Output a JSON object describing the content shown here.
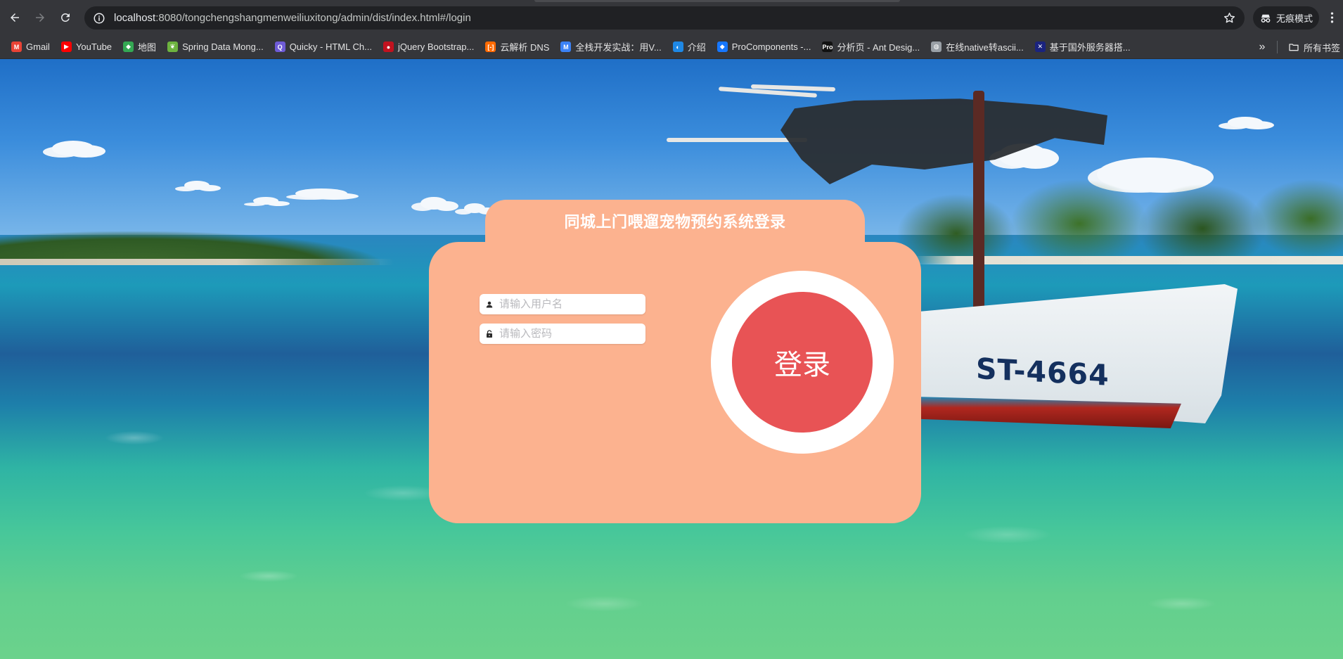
{
  "browser": {
    "url_host": "localhost",
    "url_path": ":8080/tongchengshangmenweiliuxitong/admin/dist/index.html#/login",
    "incognito_label": "无痕模式",
    "bookmarks": [
      {
        "label": "Gmail",
        "icon": "gmail-icon",
        "color": "#ea4335",
        "glyph": "M"
      },
      {
        "label": "YouTube",
        "icon": "youtube-icon",
        "color": "#ff0000",
        "glyph": "▶"
      },
      {
        "label": "地图",
        "icon": "maps-icon",
        "color": "#34a853",
        "glyph": "◆"
      },
      {
        "label": "Spring Data Mong...",
        "icon": "spring-icon",
        "color": "#6db33f",
        "glyph": "❦"
      },
      {
        "label": "Quicky - HTML Ch...",
        "icon": "quicky-icon",
        "color": "#6e5bd6",
        "glyph": "Q"
      },
      {
        "label": "jQuery Bootstrap...",
        "icon": "jquery-icon",
        "color": "#c1121f",
        "glyph": "●"
      },
      {
        "label": "云解析 DNS",
        "icon": "aliyun-icon",
        "color": "#ff6a00",
        "glyph": "[-]"
      },
      {
        "label": "全栈开发实战：用V...",
        "icon": "doc-icon",
        "color": "#3b82f6",
        "glyph": "M"
      },
      {
        "label": "介绍",
        "icon": "globe-icon",
        "color": "#1e88e5",
        "glyph": "◐"
      },
      {
        "label": "ProComponents -...",
        "icon": "antd-icon",
        "color": "#1677ff",
        "glyph": "◆"
      },
      {
        "label": "分析页 - Ant Desig...",
        "icon": "pro-icon",
        "color": "#111111",
        "glyph": "Pro"
      },
      {
        "label": "在线native转ascii...",
        "icon": "web-icon",
        "color": "#9aa0a6",
        "glyph": "◍"
      },
      {
        "label": "基于国外服务器搭...",
        "icon": "flag-icon",
        "color": "#1a237e",
        "glyph": "✕"
      }
    ],
    "all_bookmarks_label": "所有书签"
  },
  "login": {
    "title": "同城上门喂遛宠物预约系统登录",
    "username_placeholder": "请输入用户名",
    "password_placeholder": "请输入密码",
    "button_label": "登录",
    "card_color": "#fcb28f",
    "button_color": "#e85355"
  },
  "background": {
    "boat_registration": "ST-4664"
  }
}
